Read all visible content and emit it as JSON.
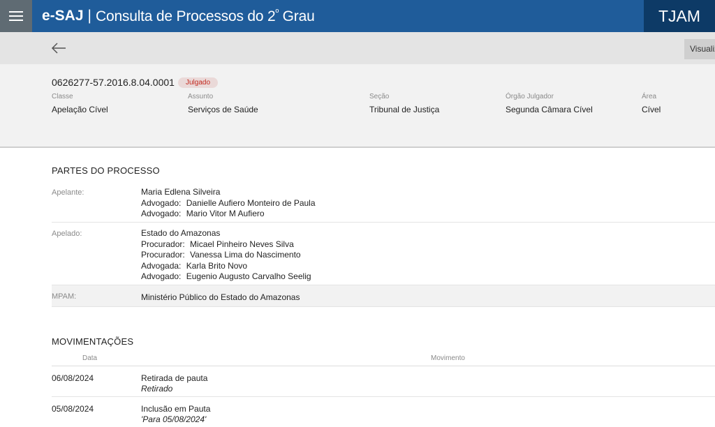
{
  "header": {
    "logo": "e-SAJ",
    "separator": "|",
    "title_main": "Consulta de Processos do 2",
    "title_sup": "º",
    "title_end": " Grau",
    "court": "TJAM"
  },
  "toolbar": {
    "back_icon": "arrow-left-icon",
    "view_button": "Visualizar"
  },
  "process": {
    "number": "0626277-57.2016.8.04.0001",
    "status": "Julgado",
    "fields": [
      {
        "label": "Classe",
        "value": "Apelação Cível"
      },
      {
        "label": "Assunto",
        "value": "Serviços de Saúde"
      },
      {
        "label": "Seção",
        "value": "Tribunal de Justiça"
      },
      {
        "label": "Órgão Julgador",
        "value": "Segunda Câmara Cível"
      },
      {
        "label": "Área",
        "value": "Cível"
      }
    ]
  },
  "parties": {
    "title": "PARTES DO PROCESSO",
    "items": [
      {
        "label": "Apelante:",
        "name": "Maria Edlena Silveira",
        "reps": [
          {
            "role": "Advogado:",
            "name": "Danielle Aufiero Monteiro de Paula"
          },
          {
            "role": "Advogado:",
            "name": "Mario Vitor M Aufiero"
          }
        ]
      },
      {
        "label": "Apelado:",
        "name": "Estado do Amazonas",
        "reps": [
          {
            "role": "Procurador:",
            "name": "Micael Pinheiro Neves Silva"
          },
          {
            "role": "Procurador:",
            "name": "Vanessa Lima do Nascimento"
          },
          {
            "role": "Advogada:",
            "name": "Karla Brito Novo"
          },
          {
            "role": "Advogado:",
            "name": "Eugenio Augusto Carvalho Seelig"
          }
        ]
      },
      {
        "label": "MPAM:",
        "name": "Ministério Público do Estado do Amazonas",
        "reps": []
      }
    ]
  },
  "movements": {
    "title": "MOVIMENTAÇÕES",
    "col_date": "Data",
    "col_movement": "Movimento",
    "rows": [
      {
        "date": "06/08/2024",
        "title": "Retirada de pauta",
        "desc": "Retirado"
      },
      {
        "date": "05/08/2024",
        "title": "Inclusão em Pauta",
        "desc": "'Para 05/08/2024'"
      }
    ]
  },
  "colors": {
    "header_blue": "#1f5c9a",
    "court_navy": "#0d3a66",
    "menu_gray": "#5f6b73",
    "status_red": "#c2281e"
  }
}
